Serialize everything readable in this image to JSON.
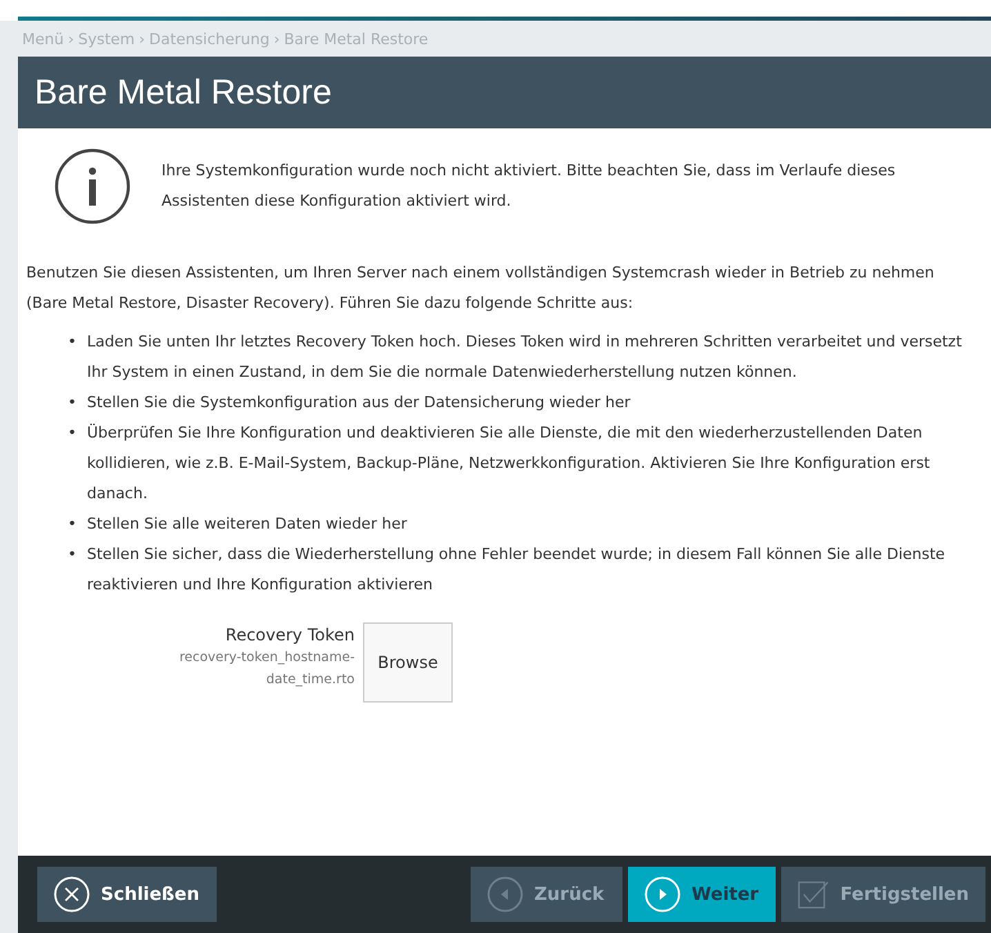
{
  "breadcrumb": [
    "Menü",
    "System",
    "Datensicherung",
    "Bare Metal Restore"
  ],
  "breadcrumb_separator": "›",
  "bullet": "•",
  "title": "Bare Metal Restore",
  "notice": "Ihre Systemkonfiguration wurde noch nicht aktiviert. Bitte beachten Sie, dass im Verlaufe dieses Assistenten diese Konfiguration aktiviert wird.",
  "intro": "Benutzen Sie diesen Assistenten, um Ihren Server nach einem vollständigen Systemcrash wieder in Betrieb zu nehmen (Bare Metal Restore, Disaster Recovery). Führen Sie dazu folgende Schritte aus:",
  "steps": [
    "Laden Sie unten Ihr letztes Recovery Token hoch. Dieses Token wird in mehreren Schritten verarbeitet und versetzt Ihr System in einen Zustand, in dem Sie die normale Datenwiederherstellung nutzen können.",
    "Stellen Sie die Systemkonfiguration aus der Datensicherung wieder her",
    "Überprüfen Sie Ihre Konfiguration und deaktivieren Sie alle Dienste, die mit den wiederherzustellenden Daten kollidieren, wie z.B. E-Mail-System, Backup-Pläne, Netzwerkkonfiguration. Aktivieren Sie Ihre Konfiguration erst danach.",
    "Stellen Sie alle weiteren Daten wieder her",
    "Stellen Sie sicher, dass die Wiederherstellung ohne Fehler beendet wurde; in diesem Fall können Sie alle Dienste reaktivieren und Ihre Konfiguration aktivieren"
  ],
  "upload": {
    "label": "Recovery Token",
    "hint": "recovery-token_hostname-date_time.rto",
    "button": "Browse"
  },
  "footer": {
    "close": {
      "label": "Schließen",
      "disabled": false
    },
    "actions": [
      {
        "kind": "back",
        "label": "Zurück",
        "disabled": true,
        "selected": false
      },
      {
        "kind": "next",
        "label": "Weiter",
        "disabled": false,
        "selected": true
      },
      {
        "kind": "finish",
        "label": "Fertigstellen",
        "disabled": true,
        "selected": false
      }
    ]
  }
}
